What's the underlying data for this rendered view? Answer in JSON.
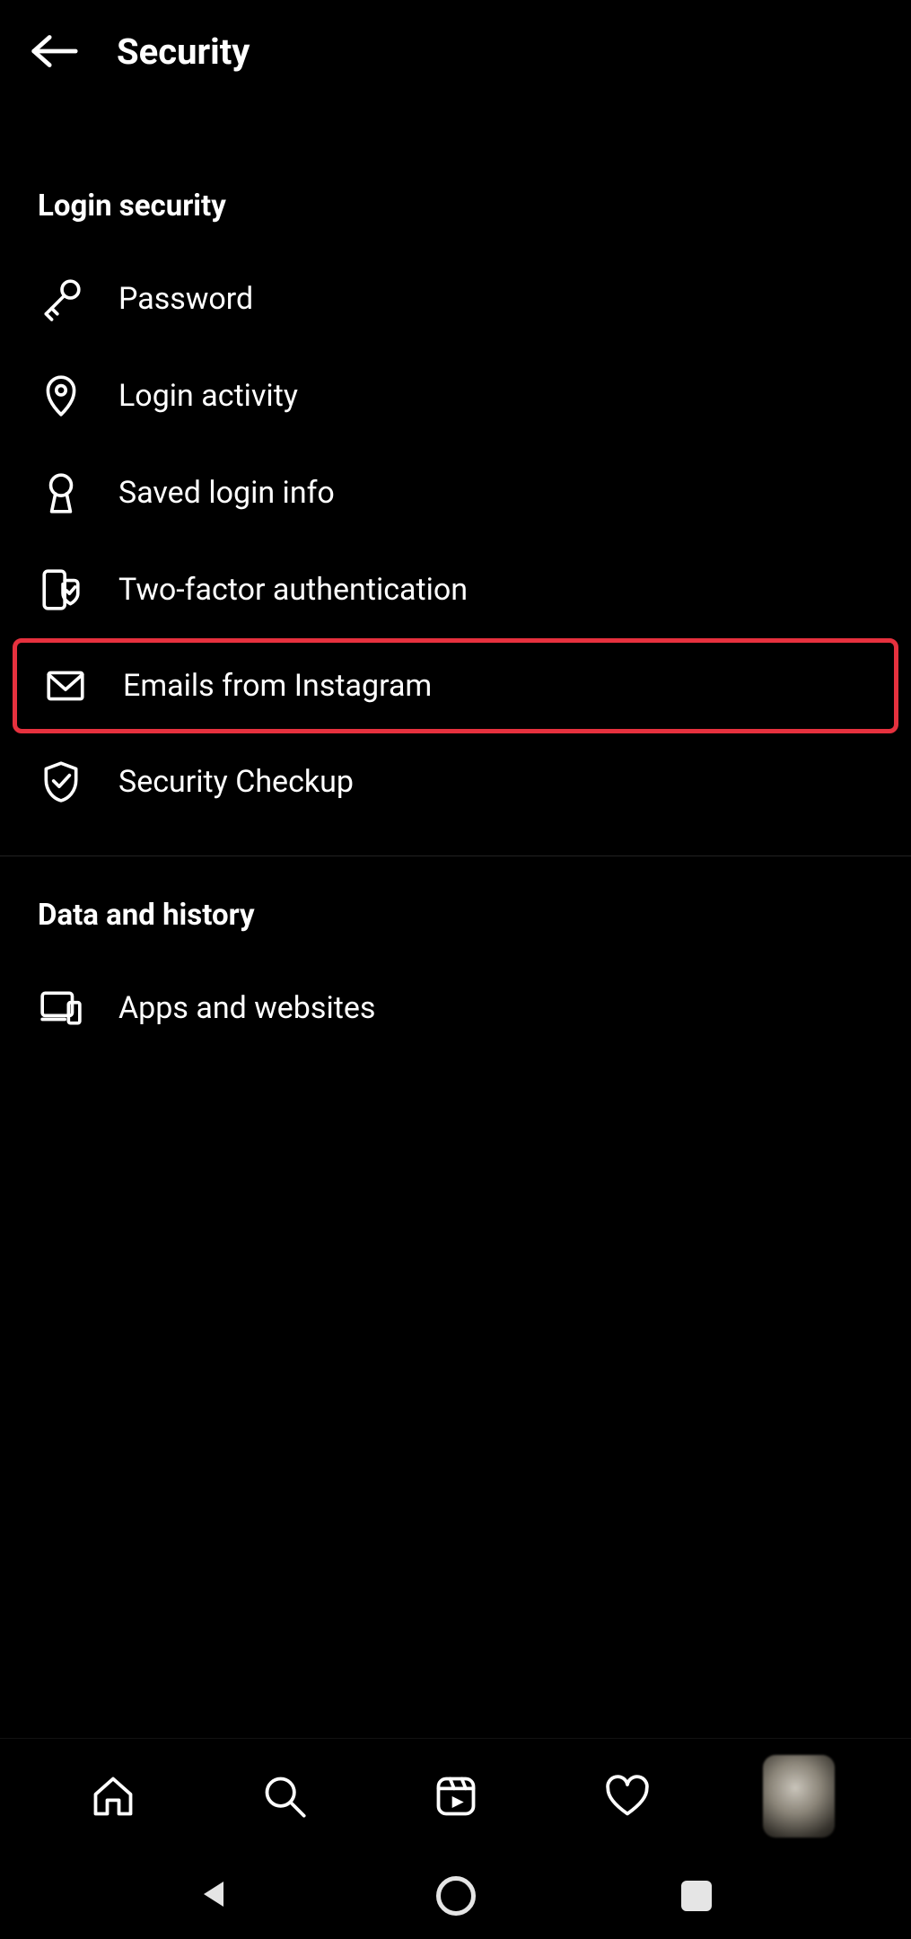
{
  "header": {
    "title": "Security"
  },
  "sections": {
    "login_security": {
      "title": "Login security",
      "items": [
        {
          "label": "Password"
        },
        {
          "label": "Login activity"
        },
        {
          "label": "Saved login info"
        },
        {
          "label": "Two-factor authentication"
        },
        {
          "label": "Emails from Instagram"
        },
        {
          "label": "Security Checkup"
        }
      ]
    },
    "data_history": {
      "title": "Data and history",
      "items": [
        {
          "label": "Apps and websites"
        }
      ]
    }
  },
  "highlight": {
    "target": "emails-from-instagram",
    "color": "#e6313e"
  },
  "bottom_nav": {
    "items": [
      "home",
      "search",
      "reels",
      "activity",
      "profile"
    ]
  }
}
